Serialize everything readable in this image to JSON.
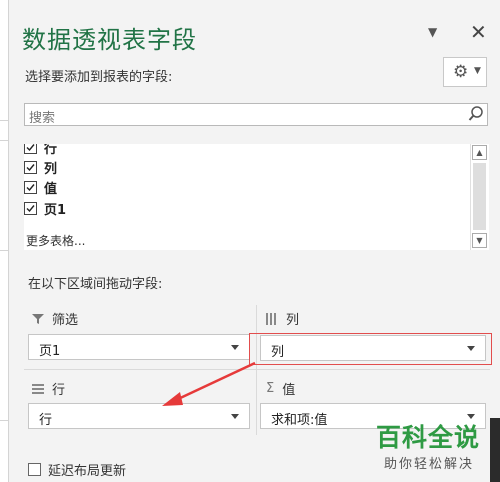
{
  "pane": {
    "title": "数据透视表字段",
    "choose_label": "选择要添加到报表的字段:",
    "search_placeholder": "搜索"
  },
  "fields": [
    {
      "label": "行",
      "checked": true
    },
    {
      "label": "列",
      "checked": true
    },
    {
      "label": "值",
      "checked": true
    },
    {
      "label": "页1",
      "checked": true
    }
  ],
  "more_tables": "更多表格...",
  "drag_label": "在以下区域间拖动字段:",
  "areas": {
    "filter": {
      "header": "筛选",
      "value": "页1"
    },
    "columns": {
      "header": "列",
      "value": "列"
    },
    "rows": {
      "header": "行",
      "value": "行"
    },
    "values": {
      "header": "值",
      "value": "求和项:值"
    }
  },
  "defer_update": {
    "label": "延迟布局更新",
    "checked": false
  },
  "watermark": {
    "big": "百科全说",
    "small": "助你轻松解决"
  },
  "colors": {
    "title": "#217346",
    "highlight": "#e24d4d",
    "watermark": "#2e9a43"
  }
}
